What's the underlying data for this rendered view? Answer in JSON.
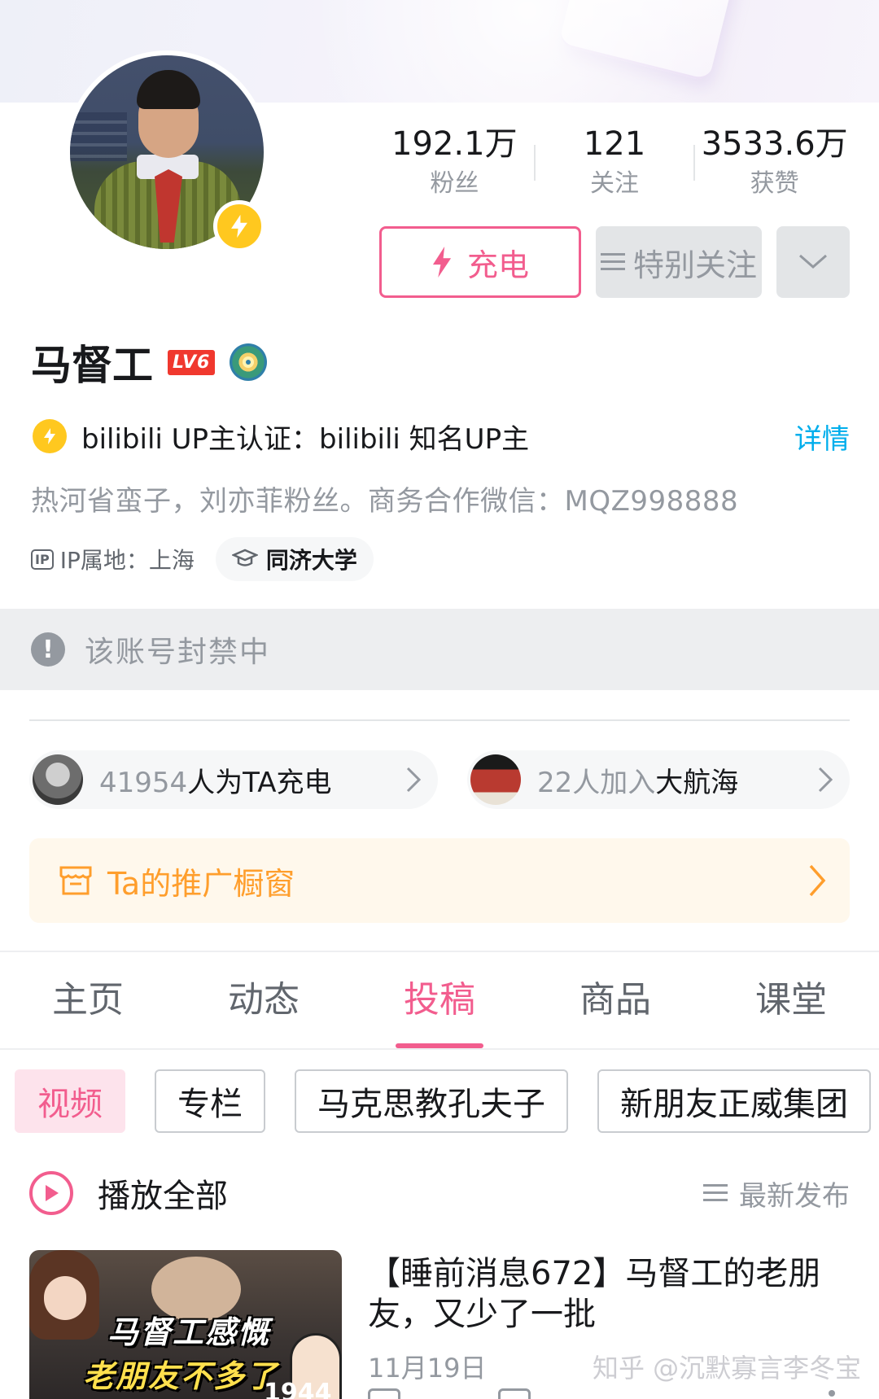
{
  "profile": {
    "name": "马督工",
    "level": "LV6",
    "stats": [
      {
        "value": "192.1万",
        "label": "粉丝"
      },
      {
        "value": "121",
        "label": "关注"
      },
      {
        "value": "3533.6万",
        "label": "获赞"
      }
    ],
    "buttons": {
      "charge": "充电",
      "special_follow": "特别关注"
    },
    "certification": "bilibili UP主认证：bilibili 知名UP主",
    "cert_detail": "详情",
    "bio": "热河省蛮子，刘亦菲粉丝。商务合作微信：MQZ998888",
    "ip_tag": "IP",
    "ip_location": "IP属地：上海",
    "school": "同济大学"
  },
  "ban_notice": "该账号封禁中",
  "supporters": {
    "charge_count": "41954",
    "charge_text": "人为TA充电",
    "fleet_count": "22",
    "fleet_text_a": "人加入",
    "fleet_text_b": "大航海"
  },
  "showcase": {
    "label": "Ta的推广橱窗"
  },
  "tabs": [
    "主页",
    "动态",
    "投稿",
    "商品",
    "课堂"
  ],
  "active_tab": "投稿",
  "chips": [
    "视频",
    "专栏",
    "马克思教孔夫子",
    "新朋友正威集团"
  ],
  "playlist": {
    "play_all": "播放全部",
    "sort": "最新发布"
  },
  "video": {
    "thumb_line1": "马督工感慨",
    "thumb_line2": "老朋友不多了",
    "thumb_year": "1944",
    "title": "【睡前消息672】马督工的老朋友，又少了一批",
    "date": "11月19日"
  },
  "watermark": "知乎 @沉默寡言李冬宝",
  "colors": {
    "accent": "#f25d8e",
    "link": "#00aeec",
    "showcase": "#ff9e2c",
    "bolt": "#ffc81f"
  }
}
